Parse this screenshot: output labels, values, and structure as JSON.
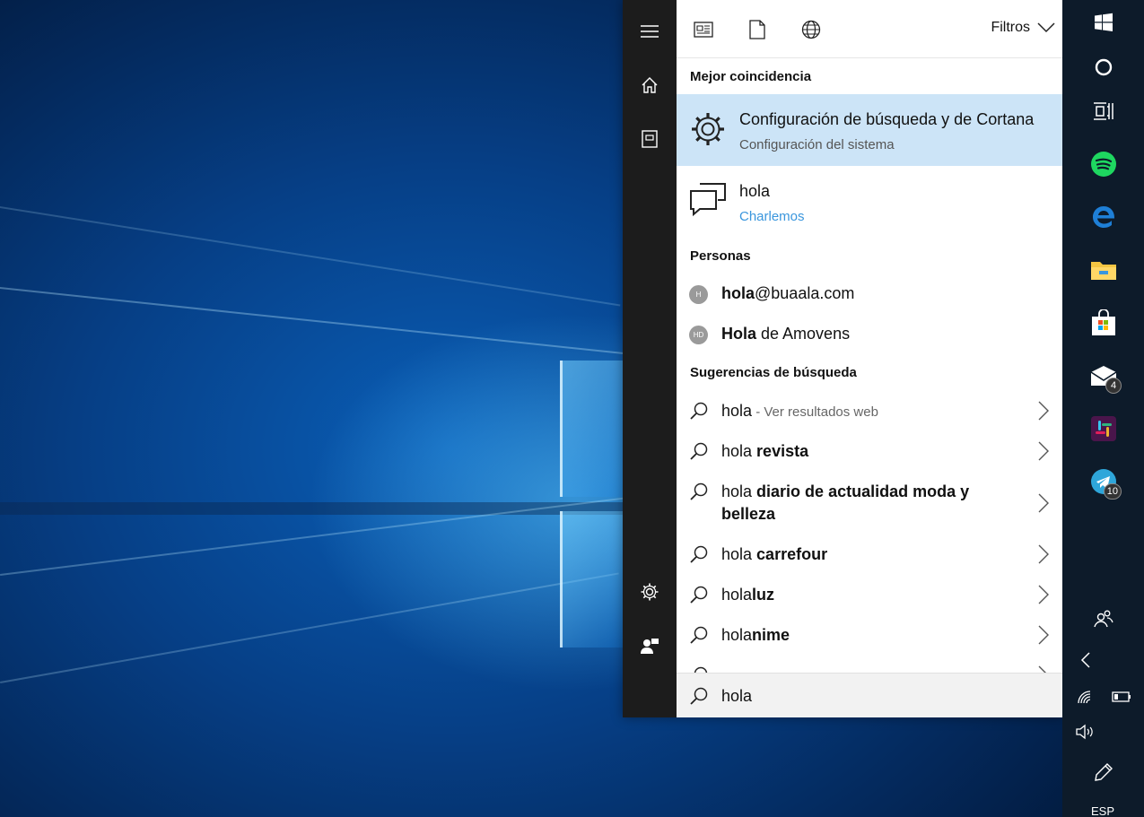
{
  "start_panel": {
    "filters_label": "Filtros",
    "best_match_heading": "Mejor coincidencia",
    "best_match": {
      "title": "Configuración de búsqueda y de Cortana",
      "subtitle": "Configuración del sistema"
    },
    "chat_result": {
      "title": "hola",
      "subtitle": "Charlemos",
      "subtitle_color": "#3a96dd"
    },
    "people_heading": "Personas",
    "people": [
      {
        "initials": "H",
        "bold": "hola",
        "rest": "@buaala.com"
      },
      {
        "initials": "HD",
        "bold": "Hola",
        "rest": " de Amovens"
      }
    ],
    "suggestions_heading": "Sugerencias de búsqueda",
    "suggestions": [
      {
        "plain": "hola",
        "bold": "",
        "muted": " - Ver resultados web"
      },
      {
        "plain": "hola ",
        "bold": "revista",
        "muted": ""
      },
      {
        "plain": "hola ",
        "bold": "diario de actualidad moda y belleza",
        "muted": ""
      },
      {
        "plain": "hola ",
        "bold": "carrefour",
        "muted": ""
      },
      {
        "plain": "hola",
        "bold": "luz",
        "muted": ""
      },
      {
        "plain": "hola",
        "bold": "nime",
        "muted": ""
      }
    ],
    "search_query": "hola"
  },
  "taskbar": {
    "mail_badge": "4",
    "telegram_badge": "10",
    "language": "ESP"
  },
  "colors": {
    "best_match_bg": "#cce4f7",
    "rail_bg": "#1c1c1c",
    "taskbar_bg": "#0d1b2a",
    "spotify": "#1ed760",
    "edge": "#1e7fd6",
    "slack": "#4a154b",
    "telegram": "#2ea6da"
  }
}
